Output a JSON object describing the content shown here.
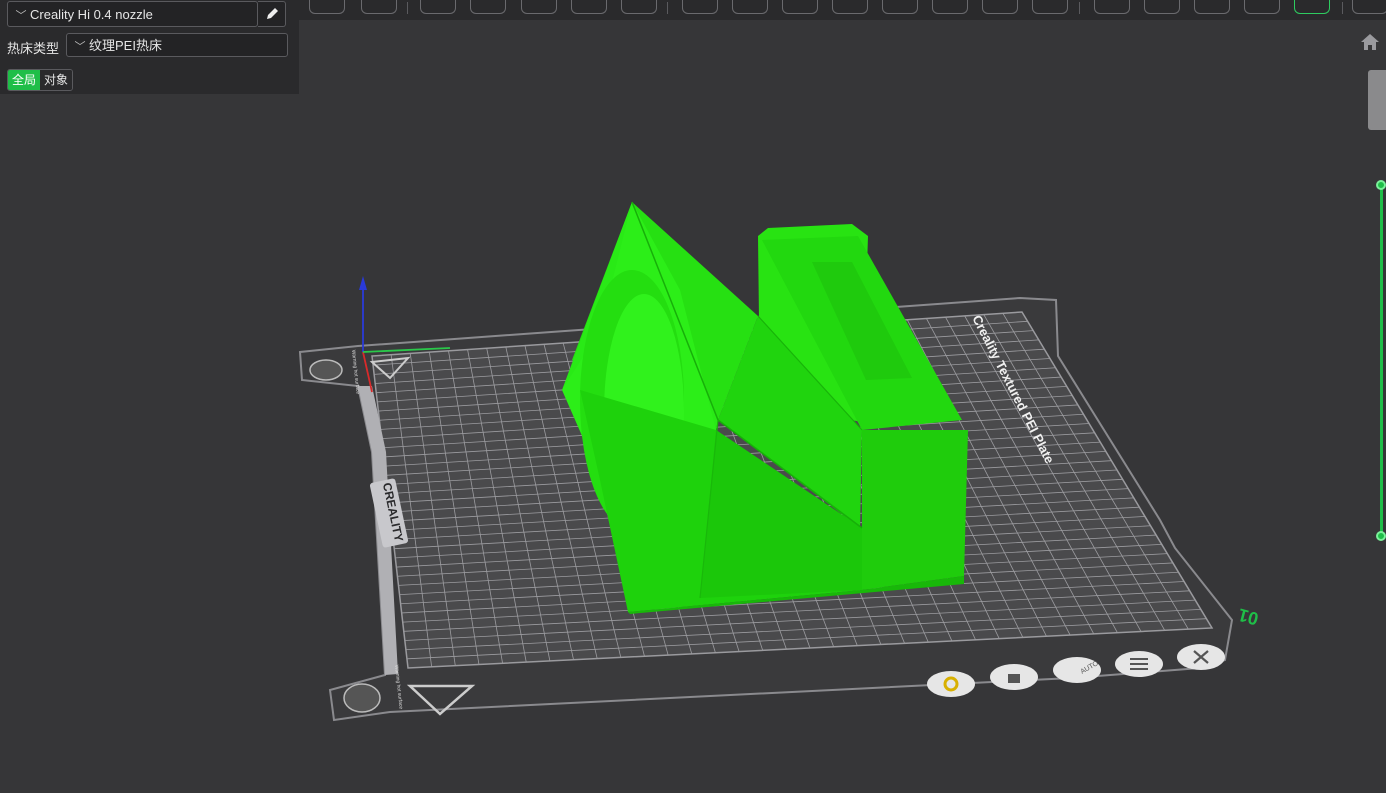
{
  "panel": {
    "printer": "Creality Hi 0.4 nozzle",
    "bed_type_label": "热床类型",
    "bed_type_value": "纹理PEI热床",
    "tab_global": "全局",
    "tab_object": "对象"
  },
  "plate": {
    "brand_text": "CREALITY",
    "plate_name": "Creality Textured PEI Plate",
    "plate_number": "01",
    "warning_text": "Warning hot surface"
  },
  "plate_toolbar": {
    "auto_label": "AUTO"
  },
  "colors": {
    "accent": "#1fbe48",
    "model": "#22dd11",
    "background": "#363638"
  }
}
